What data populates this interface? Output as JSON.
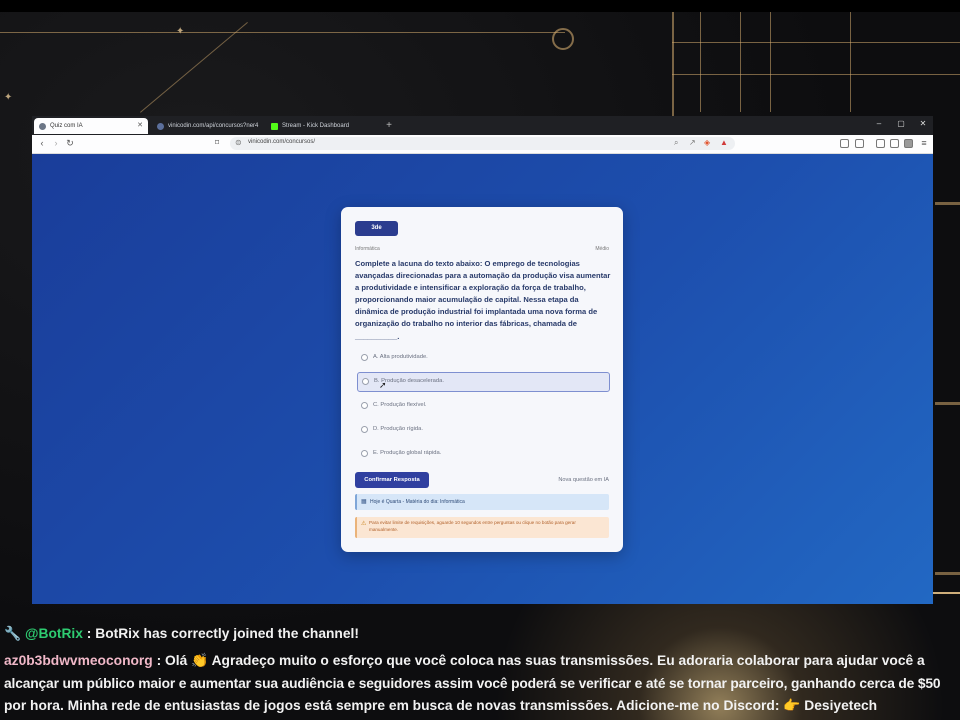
{
  "browser": {
    "tabs": [
      {
        "label": "Quiz com IA",
        "icon_color": "#6c7686",
        "active": true
      },
      {
        "label": "vinicodin.com/api/concursos?ner4",
        "icon_color": "#5b6f9c",
        "active": false
      },
      {
        "label": "Stream - Kick Dashboard",
        "icon_color": "#53fc18",
        "active": false
      }
    ],
    "new_tab": "+",
    "url": "vinicodin.com/concursos/",
    "window_controls": {
      "minimize": "–",
      "maximize": "▢",
      "close": "✕"
    }
  },
  "quiz": {
    "level_badge": "3de",
    "category_left": "Informática",
    "category_right": "Médio",
    "question": "Complete a lacuna do texto abaixo: O emprego de tecnologias avançadas direcionadas para a automação da produção visa aumentar a produtividade e intensificar a exploração da força de trabalho, proporcionando maior acumulação de capital. Nessa etapa da dinâmica de produção industrial foi implantada uma nova forma de organização do trabalho no interior das fábricas, chamada de __________.",
    "options": [
      {
        "label": "A. Alta produtividade."
      },
      {
        "label": "B. Produção desacelerada."
      },
      {
        "label": "C. Produção flexível."
      },
      {
        "label": "D. Produção rígida."
      },
      {
        "label": "E. Produção global rápida."
      }
    ],
    "selected_index": 1,
    "confirm_label": "Confirmar Resposta",
    "new_question_label": "Nova questão em IA",
    "tip": "Hoje é Quarta - Matéria do dia: Informática",
    "warning": "Para evitar limite de requisições, aguarde 10 segundos entre perguntas ou clique no botão para gerar manualmente."
  },
  "chat": [
    {
      "icon": "🔧",
      "user": "@BotRix",
      "message": ": BotRix has correctly joined the channel!"
    },
    {
      "user": "az0b3bdwvmeoconorg",
      "message_lines": [
        ": Olá 👏 Agradeço muito o esforço que você coloca nas suas transmissões. Eu adoraria colaborar para ajudar você a",
        "alcançar um público maior e aumentar sua audiência e seguidores assim você poderá se verificar e até se tornar parceiro, ganhando cerca de $50",
        "por hora. Minha rede de entusiastas de jogos está sempre em busca de novas transmissões. Adicione-me no Discord: 👉 Desiyetech"
      ]
    }
  ],
  "colors": {
    "page_bg": "#1d4fae",
    "card": "#f6f7fb",
    "accent": "#3040a0",
    "chat_user1": "#2ecc71",
    "chat_user2": "#f0b8c8"
  }
}
